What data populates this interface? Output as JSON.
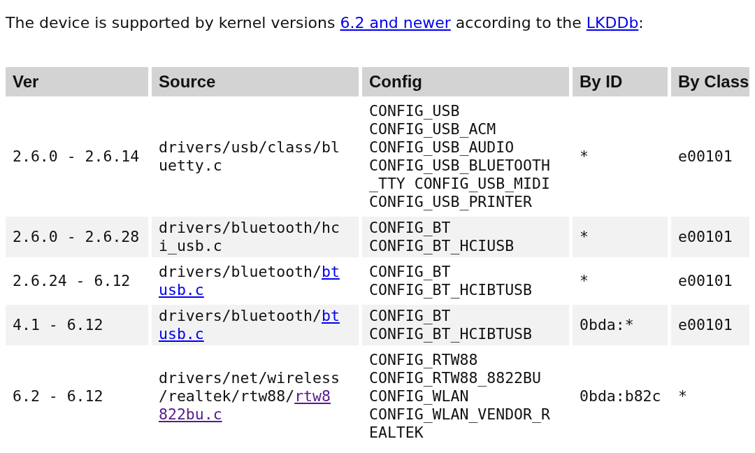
{
  "intro": [
    {
      "kind": "text",
      "text": "The device is supported by kernel versions "
    },
    {
      "kind": "link",
      "text": "6.2 and newer"
    },
    {
      "kind": "text",
      "text": " according to the "
    },
    {
      "kind": "link",
      "text": "LKDDb"
    },
    {
      "kind": "text",
      "text": ":"
    }
  ],
  "table": {
    "columns": [
      "Ver",
      "Source",
      "Config",
      "By ID",
      "By Class"
    ],
    "rows": [
      {
        "ver": "2.6.0 - 2.6.14",
        "source": {
          "path": "drivers/usb/class/bluetty.c"
        },
        "config": [
          "CONFIG_USB",
          "CONFIG_USB_ACM",
          "CONFIG_USB_AUDIO",
          "CONFIG_USB_BLUETOOTH_TTY",
          "CONFIG_USB_MIDI",
          "CONFIG_USB_PRINTER"
        ],
        "by_id": "*",
        "by_class": "e00101"
      },
      {
        "ver": "2.6.0 - 2.6.28",
        "source": {
          "path": "drivers/bluetooth/hci_usb.c"
        },
        "config": [
          "CONFIG_BT",
          "CONFIG_BT_HCIUSB"
        ],
        "by_id": "*",
        "by_class": "e00101"
      },
      {
        "ver": "2.6.24 - 6.12",
        "source": {
          "path": "drivers/bluetooth/",
          "link": "btusb.c",
          "visited": false
        },
        "config": [
          "CONFIG_BT",
          "CONFIG_BT_HCIBTUSB"
        ],
        "by_id": "*",
        "by_class": "e00101"
      },
      {
        "ver": "4.1 - 6.12",
        "source": {
          "path": "drivers/bluetooth/",
          "link": "btusb.c",
          "visited": false
        },
        "config": [
          "CONFIG_BT",
          "CONFIG_BT_HCIBTUSB"
        ],
        "by_id": "0bda:*",
        "by_class": "e00101"
      },
      {
        "ver": "6.2 - 6.12",
        "source": {
          "path": "drivers/net/wireless/realtek/rtw88/",
          "link": "rtw8822bu.c",
          "visited": true
        },
        "config": [
          "CONFIG_RTW88",
          "CONFIG_RTW88_8822BU",
          "CONFIG_WLAN",
          "CONFIG_WLAN_VENDOR_REALTEK"
        ],
        "by_id": "0bda:b82c",
        "by_class": "*"
      }
    ]
  }
}
